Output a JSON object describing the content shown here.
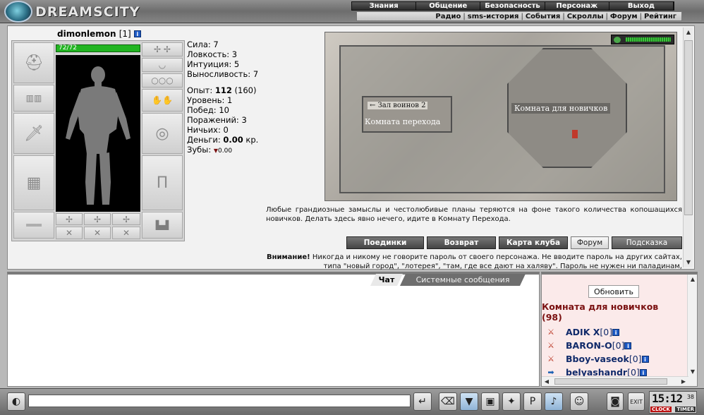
{
  "header": {
    "logo_text": "DREAMSCITY",
    "menu_main": [
      "Знания",
      "Общение",
      "Безопасность",
      "Персонаж",
      "Выход"
    ],
    "menu_sub": [
      "Радио",
      "sms-история",
      "События",
      "Скроллы",
      "Форум",
      "Рейтинг"
    ]
  },
  "character": {
    "nick": "dimonlemon",
    "level": "[1]",
    "info_icon": "i",
    "hp": "72/72",
    "stats": {
      "strength": "Сила: 7",
      "agility": "Ловкость: 3",
      "intuition": "Интуиция: 5",
      "endurance": "Выносливость: 7"
    },
    "exp_label": "Опыт: ",
    "exp_value": "112",
    "exp_next": " (160)",
    "level_line": "Уровень: 1",
    "wins": "Побед: 10",
    "losses": "Поражений: 3",
    "draws": "Ничьих: 0",
    "money_label": "Деньги: ",
    "money_value": "0.00",
    "money_unit": " кр.",
    "teeth_label": "Зубы: ",
    "teeth_value": "0.00"
  },
  "map": {
    "room_label": "Комната для новичков",
    "exit_label_top": "← Зал воинов 2",
    "exit_label_bottom": "Комната перехода"
  },
  "room_description": "Любые грандиозные замыслы и честолюбивые планы теряются на фоне такого количества копошащихся новичков. Делать здесь явно нечего, идите в Комнату Перехода.",
  "buttons": {
    "duels": "Поединки",
    "return": "Возврат",
    "club_map": "Карта клуба",
    "forum": "Форум",
    "hint": "Подсказка"
  },
  "warning": {
    "bold": "Внимание!",
    "text": " Никогда и никому не говорите пароль от своего персонажа. Не вводите пароль на других сайтах, типа \"новый город\", \"лотерея\", \"там, где все дают на халяву\". Пароль не нужен ни паладинам,"
  },
  "chat": {
    "tab_chat": "Чат",
    "tab_system": "Системные сообщения"
  },
  "users_panel": {
    "refresh": "Обновить",
    "room_name": "Комната для новичков",
    "room_count": "(98)",
    "users": [
      {
        "name": "ADIK X",
        "level": "[0]",
        "icon": "swords-icon"
      },
      {
        "name": "BARON-O",
        "level": "[0]",
        "icon": "swords-icon"
      },
      {
        "name": "Bboy-vaseok",
        "level": "[0]",
        "icon": "swords-icon"
      },
      {
        "name": "belyashandr",
        "level": "[0]",
        "icon": "arrow-icon"
      }
    ]
  },
  "clock": {
    "time": "15:12",
    "seconds": "38",
    "label_clock": "CLOCK",
    "label_timer": "TIMER"
  }
}
